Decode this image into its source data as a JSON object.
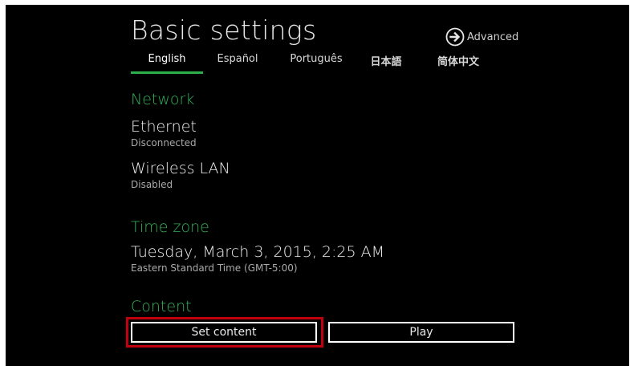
{
  "header": {
    "title": "Basic settings",
    "advanced_label": "Advanced",
    "advanced_icon": "circle-arrow-right-icon"
  },
  "languages": {
    "items": [
      "English",
      "Español",
      "Português",
      "日本語",
      "简体中文"
    ],
    "active_index": 0
  },
  "network": {
    "heading": "Network",
    "ethernet": {
      "label": "Ethernet",
      "status": "Disconnected"
    },
    "wireless": {
      "label": "Wireless LAN",
      "status": "Disabled"
    }
  },
  "timezone": {
    "heading": "Time zone",
    "datetime": "Tuesday, March 3, 2015, 2:25 AM",
    "zone": "Eastern Standard Time (GMT-5:00)"
  },
  "content": {
    "heading": "Content",
    "set_content_label": "Set content",
    "play_label": "Play"
  },
  "colors": {
    "accent": "#2db04b",
    "highlight": "#c0000f",
    "background": "#000000"
  }
}
